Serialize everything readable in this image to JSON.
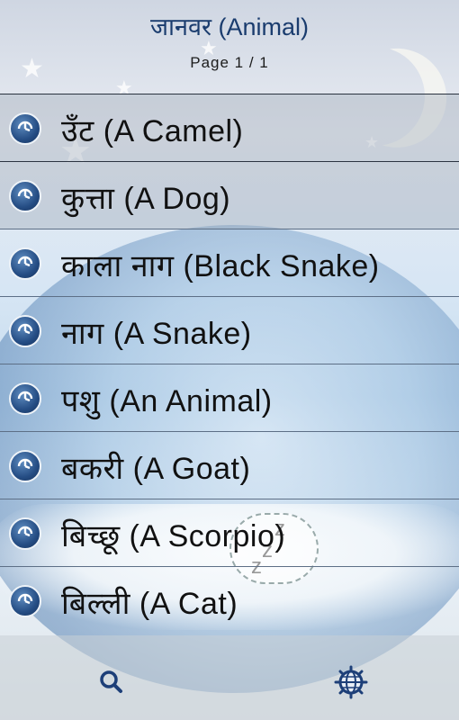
{
  "header": {
    "title": "जानवर (Animal)",
    "page_indicator": "Page  1 / 1"
  },
  "list": {
    "items": [
      {
        "label": "उँट (A Camel)",
        "icon": "play-sound-icon"
      },
      {
        "label": "कुत्ता (A Dog)",
        "icon": "play-sound-icon"
      },
      {
        "label": "काला नाग (Black Snake)",
        "icon": "play-sound-icon"
      },
      {
        "label": "नाग (A Snake)",
        "icon": "play-sound-icon"
      },
      {
        "label": "पशु (An Animal)",
        "icon": "play-sound-icon"
      },
      {
        "label": "बकरी (A Goat)",
        "icon": "play-sound-icon"
      },
      {
        "label": "बिच्छू (A Scorpio)",
        "icon": "play-sound-icon"
      },
      {
        "label": "बिल्ली (A Cat)",
        "icon": "play-sound-icon"
      }
    ]
  },
  "bottom_bar": {
    "search_icon": "search-icon",
    "settings_icon": "settings-globe-icon"
  },
  "colors": {
    "title": "#1a3c6e",
    "icon_blue": "#254d84",
    "bar_icon": "#1d3f78"
  }
}
